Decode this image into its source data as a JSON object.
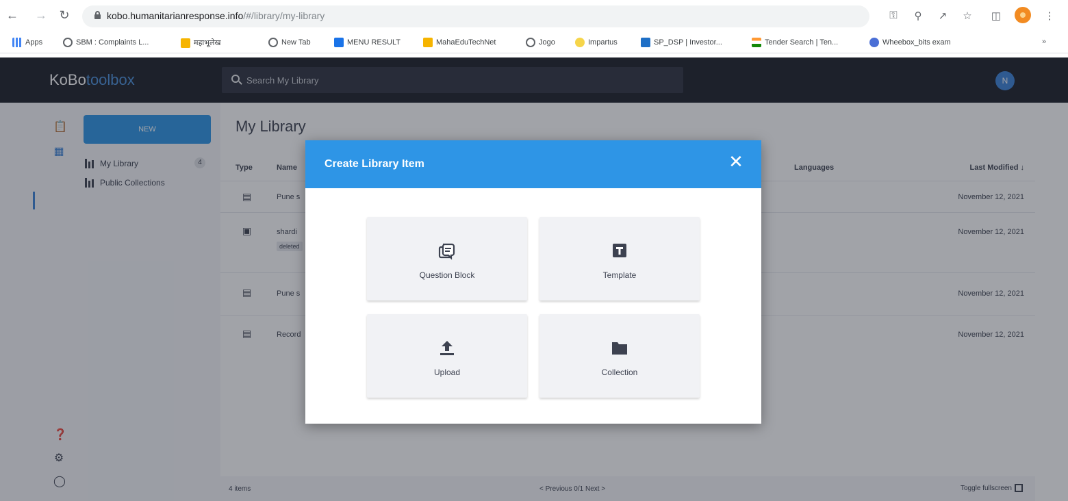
{
  "browser": {
    "url_host": "kobo.humanitarianresponse.info",
    "url_path": "/#/library/my-library",
    "bookmarks": [
      {
        "label": "Apps",
        "icon": "apps-grid-icon"
      },
      {
        "label": "SBM : Complaints L...",
        "icon": "globe-icon"
      },
      {
        "label": "महाभूलेख",
        "icon": "folder-icon"
      },
      {
        "label": "New Tab",
        "icon": "globe-icon"
      },
      {
        "label": "MENU RESULT",
        "icon": "grid-icon"
      },
      {
        "label": "MahaEduTechNet",
        "icon": "folder-icon"
      },
      {
        "label": "Jogo",
        "icon": "globe-icon"
      },
      {
        "label": "Impartus",
        "icon": "star-icon"
      },
      {
        "label": "SP_DSP | Investor...",
        "icon": "square-icon"
      },
      {
        "label": "Tender Search | Ten...",
        "icon": "flag-icon"
      },
      {
        "label": "Wheebox_bits exam",
        "icon": "wheebox-icon"
      }
    ]
  },
  "header": {
    "logo_brand": "KoBo",
    "logo_suffix": "toolbox",
    "search_placeholder": "Search My Library",
    "avatar_initial": "N"
  },
  "sidebar": {
    "new_button": "NEW",
    "items": [
      {
        "label": "My Library",
        "count": "4"
      },
      {
        "label": "Public Collections"
      }
    ]
  },
  "main": {
    "title": "My Library",
    "columns": {
      "type": "Type",
      "name": "Name",
      "languages": "Languages",
      "last_modified": "Last Modified ↓"
    },
    "rows": [
      {
        "type_icon": "question-block-icon",
        "name": "Pune s",
        "date": "November 12, 2021"
      },
      {
        "type_icon": "template-icon",
        "name": "shardi",
        "tag": "deleted",
        "date": "November 12, 2021"
      },
      {
        "type_icon": "question-block-icon",
        "name": "Pune s",
        "date": "November 12, 2021"
      },
      {
        "type_icon": "question-block-icon",
        "name": "Record",
        "date": "November 12, 2021"
      }
    ],
    "footer": {
      "count": "4 items",
      "pagination": "< Previous  0/1  Next >",
      "toggle_fullscreen": "Toggle fullscreen"
    }
  },
  "modal": {
    "title": "Create Library Item",
    "close_icon": "close-icon",
    "options": [
      {
        "label": "Question Block",
        "icon": "question-block-icon"
      },
      {
        "label": "Template",
        "icon": "template-icon"
      },
      {
        "label": "Upload",
        "icon": "upload-icon"
      },
      {
        "label": "Collection",
        "icon": "folder-icon"
      }
    ]
  },
  "colors": {
    "kobo_blue": "#2e95e6",
    "header_dark": "#1d2029",
    "text_dark": "#3d4250"
  }
}
